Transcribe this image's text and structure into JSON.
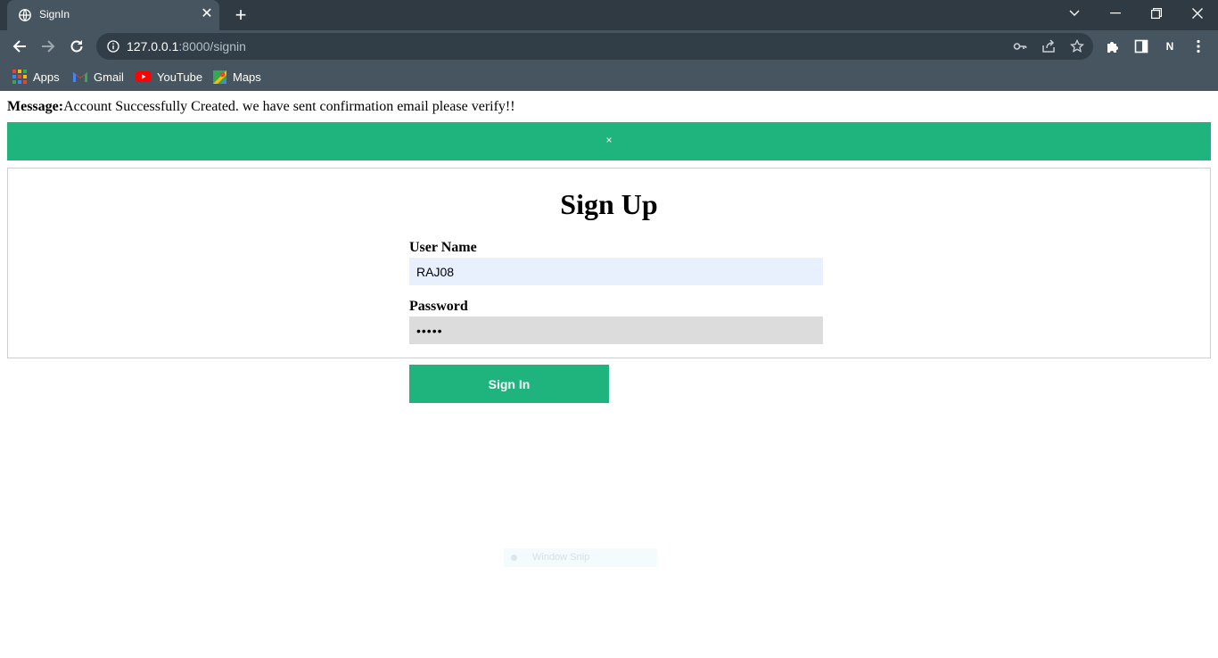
{
  "browser": {
    "tab": {
      "title": "SignIn",
      "close_glyph": "✕"
    },
    "new_tab_glyph": "+",
    "address": {
      "host": "127.0.0.1",
      "rest": ":8000/signin"
    },
    "profile_initial": "N",
    "bookmarks": [
      {
        "label": "Apps",
        "icon": "apps-grid-icon"
      },
      {
        "label": "Gmail",
        "icon": "gmail-icon"
      },
      {
        "label": "YouTube",
        "icon": "youtube-icon"
      },
      {
        "label": "Maps",
        "icon": "maps-icon"
      }
    ],
    "accent": "#46555f"
  },
  "page": {
    "message": {
      "prefix": "Message:",
      "text": "Account Successfully Created. we have sent confirmation email please verify!!"
    },
    "alert": {
      "close_glyph": "×",
      "color": "#1fb37e"
    },
    "form": {
      "title": "Sign Up",
      "username_label": "User Name",
      "username_value": "RAJ08",
      "password_label": "Password",
      "password_value": "•••••"
    },
    "submit_label": "Sign In",
    "overlay_label": "Window Snip"
  }
}
